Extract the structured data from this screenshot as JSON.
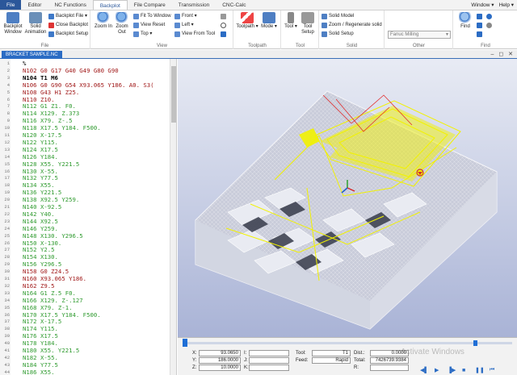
{
  "menubar": {
    "tabs": [
      "File",
      "Editor",
      "NC Functions",
      "Backplot",
      "File Compare",
      "Transmission",
      "CNC-Calc"
    ],
    "active_tab": "Backplot",
    "right": [
      "Window ▾",
      "Help ▾"
    ]
  },
  "ribbon": {
    "file_group": {
      "label": "File",
      "backplot_window": "Backplot Window",
      "solid_animation": "Solid Animation",
      "backplot_file": "Backplot File ▾",
      "close_backplot": "Close Backplot",
      "backplot_setup": "Backplot Setup"
    },
    "view_group": {
      "label": "View",
      "zoom_in": "Zoom In",
      "zoom_out": "Zoom Out",
      "fit_to_window": "Fit To Window",
      "view_reset": "View Reset",
      "top": "Top ▾",
      "front": "Front ▾",
      "left": "Left ▾",
      "view_from_tool": "View From Tool"
    },
    "toolpath_group": {
      "label": "Toolpath",
      "toolpath": "Toolpath ▾",
      "mode": "Mode ▾"
    },
    "tool_group": {
      "label": "Tool",
      "tool": "Tool ▾",
      "tool_setup": "Tool Setup"
    },
    "solid_group": {
      "label": "Solid",
      "solid_model": "Solid Model",
      "zoom_regen": "Zoom / Regenerate solid",
      "solid_setup": "Solid Setup"
    },
    "other_group": {
      "label": "Other",
      "machine": "Fanuc Milling"
    },
    "find_group": {
      "label": "Find",
      "find": "Find"
    }
  },
  "document_tab": "BRACKET SAMPLE.NC",
  "editor": {
    "lines": [
      {
        "n": "1",
        "text": "%",
        "color": "#000000"
      },
      {
        "n": "2",
        "text": "N102 G0 G17 G40 G49 G80 G90",
        "color": "#a01818"
      },
      {
        "n": "3",
        "text": "N104 T1 M6",
        "color": "#000000"
      },
      {
        "n": "4",
        "text": "N106 G0 G90 G54 X93.065 Y186. A0. S3(",
        "color": "#a01818"
      },
      {
        "n": "5",
        "text": "N108 G43 H1 Z25.",
        "color": "#a01818"
      },
      {
        "n": "6",
        "text": "N110 Z10.",
        "color": "#a01818"
      },
      {
        "n": "7",
        "text": "N112 G1 Z1. F0.",
        "color": "#2e9a2e"
      },
      {
        "n": "8",
        "text": "N114 X129. Z.373",
        "color": "#2e9a2e"
      },
      {
        "n": "9",
        "text": "N116 X79. Z-.5",
        "color": "#2e9a2e"
      },
      {
        "n": "10",
        "text": "N118 X17.5 Y184. F500.",
        "color": "#2e9a2e"
      },
      {
        "n": "11",
        "text": "N120 X-17.5",
        "color": "#2e9a2e"
      },
      {
        "n": "12",
        "text": "N122 Y115.",
        "color": "#2e9a2e"
      },
      {
        "n": "13",
        "text": "N124 X17.5",
        "color": "#2e9a2e"
      },
      {
        "n": "14",
        "text": "N126 Y184.",
        "color": "#2e9a2e"
      },
      {
        "n": "15",
        "text": "N128 X55. Y221.5",
        "color": "#2e9a2e"
      },
      {
        "n": "16",
        "text": "N130 X-55.",
        "color": "#2e9a2e"
      },
      {
        "n": "17",
        "text": "N132 Y77.5",
        "color": "#2e9a2e"
      },
      {
        "n": "18",
        "text": "N134 X55.",
        "color": "#2e9a2e"
      },
      {
        "n": "19",
        "text": "N136 Y221.5",
        "color": "#2e9a2e"
      },
      {
        "n": "20",
        "text": "N138 X92.5 Y259.",
        "color": "#2e9a2e"
      },
      {
        "n": "21",
        "text": "N140 X-92.5",
        "color": "#2e9a2e"
      },
      {
        "n": "22",
        "text": "N142 Y40.",
        "color": "#2e9a2e"
      },
      {
        "n": "23",
        "text": "N144 X92.5",
        "color": "#2e9a2e"
      },
      {
        "n": "24",
        "text": "N146 Y259.",
        "color": "#2e9a2e"
      },
      {
        "n": "25",
        "text": "N148 X130. Y296.5",
        "color": "#2e9a2e"
      },
      {
        "n": "26",
        "text": "N150 X-130.",
        "color": "#2e9a2e"
      },
      {
        "n": "27",
        "text": "N152 Y2.5",
        "color": "#2e9a2e"
      },
      {
        "n": "28",
        "text": "N154 X130.",
        "color": "#2e9a2e"
      },
      {
        "n": "29",
        "text": "N156 Y296.5",
        "color": "#2e9a2e"
      },
      {
        "n": "30",
        "text": "N158 G0 Z24.5",
        "color": "#a01818"
      },
      {
        "n": "31",
        "text": "N160 X93.065 Y186.",
        "color": "#a01818"
      },
      {
        "n": "32",
        "text": "N162 Z9.5",
        "color": "#a01818"
      },
      {
        "n": "33",
        "text": "N164 G1 Z.5 F0.",
        "color": "#2e9a2e"
      },
      {
        "n": "34",
        "text": "N166 X129. Z-.127",
        "color": "#2e9a2e"
      },
      {
        "n": "35",
        "text": "N168 X79. Z-1.",
        "color": "#2e9a2e"
      },
      {
        "n": "36",
        "text": "N170 X17.5 Y184. F500.",
        "color": "#2e9a2e"
      },
      {
        "n": "37",
        "text": "N172 X-17.5",
        "color": "#2e9a2e"
      },
      {
        "n": "38",
        "text": "N174 Y115.",
        "color": "#2e9a2e"
      },
      {
        "n": "39",
        "text": "N176 X17.5",
        "color": "#2e9a2e"
      },
      {
        "n": "40",
        "text": "N178 Y184.",
        "color": "#2e9a2e"
      },
      {
        "n": "41",
        "text": "N180 X55. Y221.5",
        "color": "#2e9a2e"
      },
      {
        "n": "42",
        "text": "N182 X-55.",
        "color": "#2e9a2e"
      },
      {
        "n": "43",
        "text": "N184 Y77.5",
        "color": "#2e9a2e"
      },
      {
        "n": "44",
        "text": "N186 X55.",
        "color": "#2e9a2e"
      }
    ]
  },
  "status": {
    "x_label": "X:",
    "x_value": "93.0650",
    "y_label": "Y:",
    "y_value": "186.0000",
    "z_label": "Z:",
    "z_value": "10.0000",
    "i_label": "I:",
    "j_label": "J:",
    "k_label": "K:",
    "tool_label": "Tool:",
    "tool_value": "T1",
    "feed_label": "Feed:",
    "feed_value": "Rapid",
    "dist_label": "Dist.:",
    "dist_value": "0.0000",
    "total_label": "Total:",
    "total_value": "7426739.9384",
    "r_label": "R:",
    "watermark": "Activate Windows"
  },
  "colors": {
    "accent": "#2b579a",
    "toolpath": "#f2f200",
    "mesh": "#ffffff",
    "viewport_top": "#e8ebf4",
    "viewport_bottom": "#a9b3d6"
  }
}
